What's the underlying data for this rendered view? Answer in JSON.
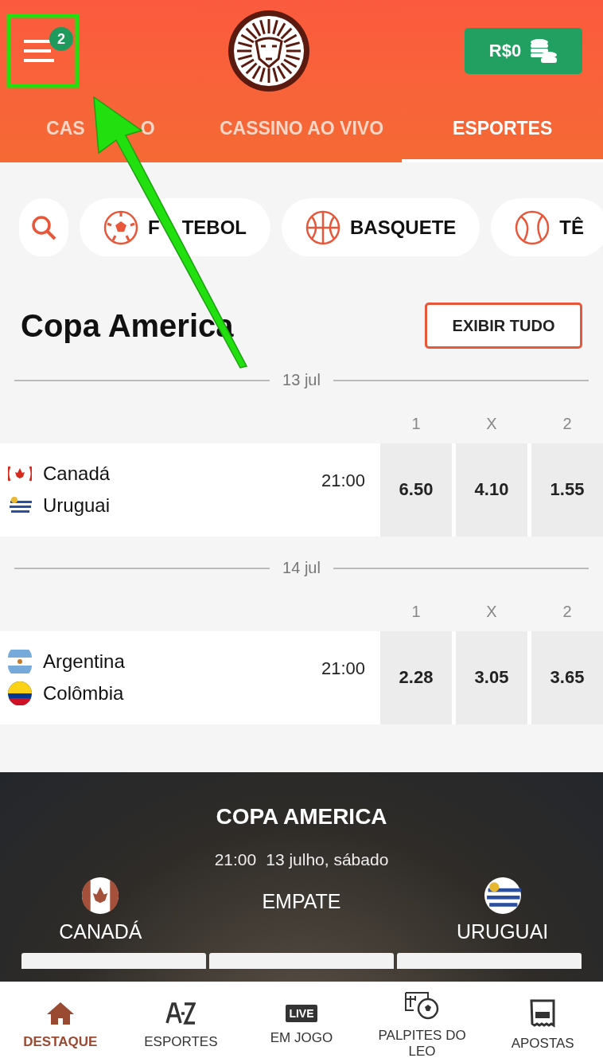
{
  "header": {
    "badge": "2",
    "balance": "R$0"
  },
  "tabs": [
    {
      "label": "CAS",
      "label_end": "O",
      "selected": false
    },
    {
      "label": "CASSINO AO VIVO",
      "selected": false
    },
    {
      "label": "ESPORTES",
      "selected": true
    }
  ],
  "sports": [
    {
      "label": "F",
      "label_end": "TEBOL"
    },
    {
      "label": "BASQUETE"
    },
    {
      "label": "TÊ"
    }
  ],
  "section": {
    "title": "Copa America",
    "button": "EXIBIR TUDO"
  },
  "days": [
    {
      "date": "13 jul",
      "columns": [
        "1",
        "X",
        "2"
      ],
      "matches": [
        {
          "teams": [
            "Canadá",
            "Uruguai"
          ],
          "time": "21:00",
          "odds": [
            "6.50",
            "4.10",
            "1.55"
          ]
        }
      ]
    },
    {
      "date": "14 jul",
      "columns": [
        "1",
        "X",
        "2"
      ],
      "matches": [
        {
          "teams": [
            "Argentina",
            "Colômbia"
          ],
          "time": "21:00",
          "odds": [
            "2.28",
            "3.05",
            "3.65"
          ]
        }
      ]
    }
  ],
  "banner": {
    "title": "COPA AMERICA",
    "time": "21:00",
    "date": "13 julho, sábado",
    "home": "CANADÁ",
    "draw": "EMPATE",
    "away": "URUGUAI"
  },
  "nav": [
    {
      "label": "DESTAQUE",
      "selected": true
    },
    {
      "label": "ESPORTES",
      "selected": false
    },
    {
      "label": "EM JOGO",
      "selected": false,
      "badge": "LIVE"
    },
    {
      "label": "PALPITES DO LEO",
      "selected": false
    },
    {
      "label": "APOSTAS",
      "selected": false
    }
  ]
}
